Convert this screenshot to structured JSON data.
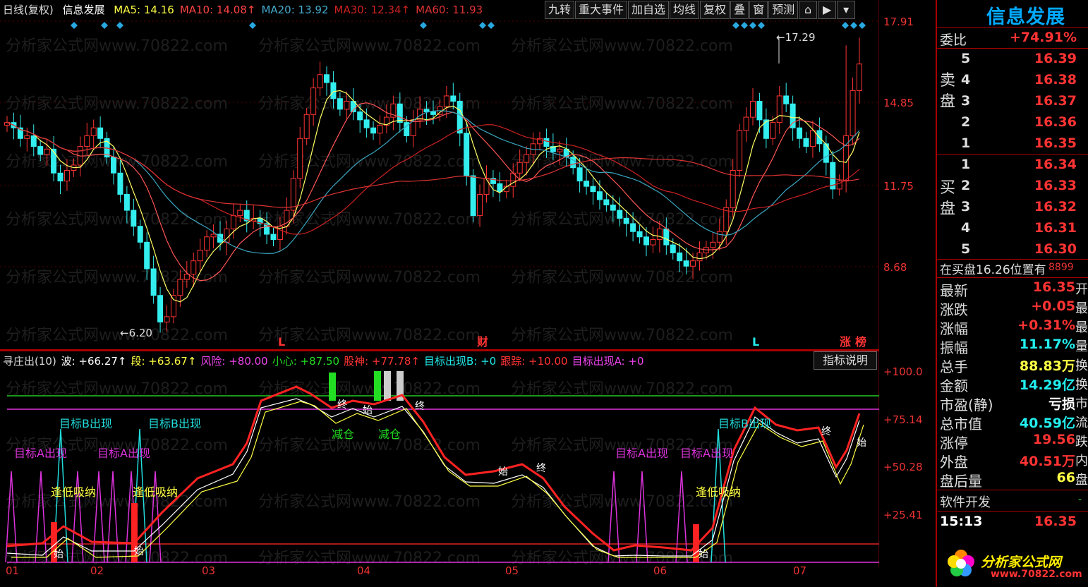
{
  "header": {
    "period": "日线(复权)",
    "stock_name": "信息发展",
    "ma": [
      {
        "label": "MA5:",
        "value": "14.16",
        "color": "#ffff44"
      },
      {
        "label": "MA10:",
        "value": "14.08↑",
        "color": "#ff4444"
      },
      {
        "label": "MA20:",
        "value": "13.92",
        "color": "#44aacc"
      },
      {
        "label": "MA30:",
        "value": "12.34↑",
        "color": "#cc2222"
      },
      {
        "label": "MA60:",
        "value": "11.93",
        "color": "#dd3333"
      }
    ]
  },
  "toolbar": {
    "buttons": [
      "九转",
      "重大事件",
      "加自选",
      "均线",
      "复权",
      "叠",
      "窗",
      "预测"
    ],
    "lock_icon": "lock-icon",
    "export_icon": "export-icon",
    "dropdown_icon": "chevron-down-icon"
  },
  "price_axis": [
    "17.91",
    "14.85",
    "11.75",
    "8.68"
  ],
  "price_markers": {
    "high": "←17.29",
    "low": "←6.20"
  },
  "event_marks": [
    {
      "text": "L",
      "color": "#ff3333"
    },
    {
      "text": "财",
      "color": "#ff3333"
    },
    {
      "text": "L",
      "color": "#22eeee"
    },
    {
      "text": "涨",
      "color": "#ff3333"
    },
    {
      "text": "榜",
      "color": "#ff3333"
    }
  ],
  "watermark": "分析家公式网www.70822.com",
  "indicator": {
    "name": "寻庄出(10)",
    "items": [
      {
        "label": "波:",
        "value": "+66.27↑",
        "color": "#ffffff"
      },
      {
        "label": "段:",
        "value": "+63.67↑",
        "color": "#ffff44"
      },
      {
        "label": "风险:",
        "value": "+80.00",
        "color": "#ee44ee"
      },
      {
        "label": "小心:",
        "value": "+87.50",
        "color": "#22dd22"
      },
      {
        "label": "股神:",
        "value": "+77.78↑",
        "color": "#ff3333"
      },
      {
        "label": "目标出现B:",
        "value": "+0",
        "color": "#22eeee"
      },
      {
        "label": "跟踪:",
        "value": "+10.00",
        "color": "#ff3333"
      },
      {
        "label": "目标出现A:",
        "value": "+0",
        "color": "#ee44ee"
      }
    ],
    "explain_button": "指标说明",
    "axis": [
      "+100.0",
      "+75.14",
      "+50.28",
      "+25.41"
    ],
    "annotations": {
      "target_b": "目标B出现",
      "target_a": "目标A出现",
      "buy_low": "逢低吸纳",
      "reduce": "减仓",
      "start": "始",
      "end": "终"
    }
  },
  "months": [
    "01",
    "02",
    "03",
    "04",
    "05",
    "06",
    "07"
  ],
  "right_panel": {
    "title": "信息发展",
    "weibi": {
      "label": "委比",
      "value": "+74.91%"
    },
    "sell_label": "卖盘",
    "buy_label": "买盘",
    "sell": [
      {
        "n": "5",
        "p": "16.39"
      },
      {
        "n": "4",
        "p": "16.38"
      },
      {
        "n": "3",
        "p": "16.37"
      },
      {
        "n": "2",
        "p": "16.36"
      },
      {
        "n": "1",
        "p": "16.35"
      }
    ],
    "buy": [
      {
        "n": "1",
        "p": "16.34"
      },
      {
        "n": "2",
        "p": "16.33"
      },
      {
        "n": "3",
        "p": "16.32"
      },
      {
        "n": "4",
        "p": "16.31"
      },
      {
        "n": "5",
        "p": "16.30"
      }
    ],
    "notice": "在买盘16.26位置有",
    "notice_num": "8899",
    "stats": [
      {
        "l": "最新",
        "v": "16.35",
        "c": "red",
        "s": "开"
      },
      {
        "l": "涨跌",
        "v": "+0.05",
        "c": "red",
        "s": "最"
      },
      {
        "l": "涨幅",
        "v": "+0.31%",
        "c": "red",
        "s": "最"
      },
      {
        "l": "振幅",
        "v": "11.17%",
        "c": "cyan",
        "s": "量"
      },
      {
        "l": "总手",
        "v": "88.83万",
        "c": "yellow",
        "s": "换"
      },
      {
        "l": "金额",
        "v": "14.29亿",
        "c": "cyan",
        "s": "换"
      },
      {
        "l": "市盈(静)",
        "v": "亏损",
        "c": "white",
        "s": "市"
      },
      {
        "l": "总市值",
        "v": "40.59亿",
        "c": "cyan",
        "s": "流"
      },
      {
        "l": "涨停",
        "v": "19.56",
        "c": "red",
        "s": "跌"
      },
      {
        "l": "外盘",
        "v": "40.51万",
        "c": "red",
        "s": "内"
      },
      {
        "l": "盘后量",
        "v": "66",
        "c": "yellow",
        "s": "盘"
      }
    ],
    "software": "软件开发",
    "software_mark": "-",
    "time": "15:13",
    "time_price": "16.35",
    "logo_text": "分析家公式网",
    "logo_url": "www.70822.com"
  }
}
